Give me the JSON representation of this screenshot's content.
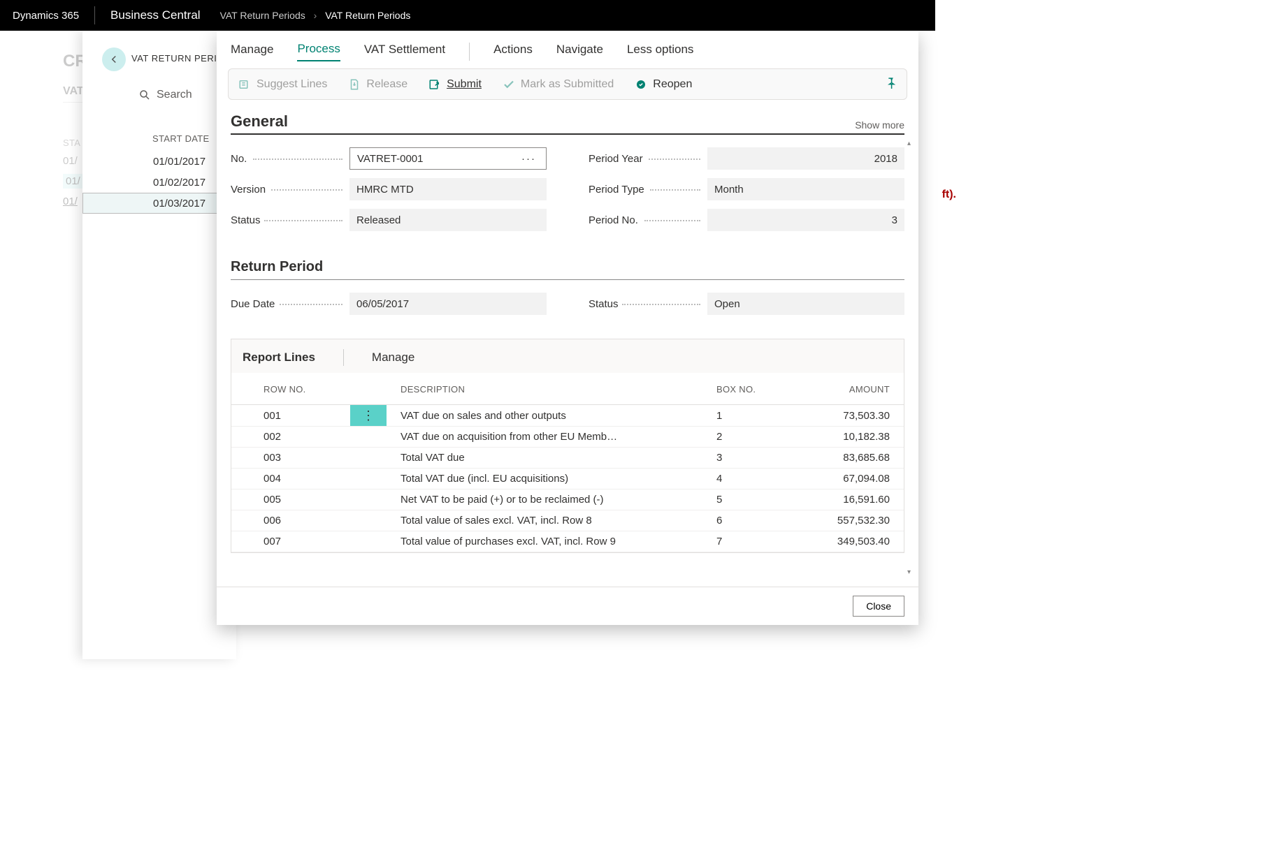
{
  "topbar": {
    "brand": "Dynamics 365",
    "app": "Business Central",
    "crumb1": "VAT Return Periods",
    "crumb2": "VAT Return Periods"
  },
  "bg": {
    "title": "CR",
    "sub": "VAT",
    "th": "STA",
    "rows": [
      "01/",
      "01/",
      "01/"
    ],
    "rightText": "ft)."
  },
  "listPanel": {
    "title": "VAT RETURN PERI",
    "searchPlaceholder": "Search",
    "header": "START DATE",
    "rows": [
      "01/01/2017",
      "01/02/2017",
      "01/03/2017"
    ],
    "selectedIndex": 2
  },
  "modal": {
    "tabs": [
      "Manage",
      "Process",
      "VAT Settlement",
      "Actions",
      "Navigate",
      "Less options"
    ],
    "activeTab": 1,
    "ribbon": {
      "suggest": "Suggest Lines",
      "release": "Release",
      "submit": "Submit",
      "mark": "Mark as Submitted",
      "reopen": "Reopen"
    },
    "general": {
      "title": "General",
      "showMore": "Show more",
      "noLabel": "No.",
      "noValue": "VATRET-0001",
      "versionLabel": "Version",
      "versionValue": "HMRC MTD",
      "statusLabel": "Status",
      "statusValue": "Released",
      "periodYearLabel": "Period Year",
      "periodYearValue": "2018",
      "periodTypeLabel": "Period Type",
      "periodTypeValue": "Month",
      "periodNoLabel": "Period No.",
      "periodNoValue": "3"
    },
    "returnPeriod": {
      "title": "Return Period",
      "dueLabel": "Due Date",
      "dueValue": "06/05/2017",
      "statusLabel": "Status",
      "statusValue": "Open"
    },
    "lines": {
      "tabs": [
        "Report Lines",
        "Manage"
      ],
      "columns": [
        "ROW NO.",
        "DESCRIPTION",
        "BOX NO.",
        "AMOUNT"
      ],
      "rows": [
        {
          "row": "001",
          "desc": "VAT due on sales and other outputs",
          "box": "1",
          "amount": "73,503.30"
        },
        {
          "row": "002",
          "desc": "VAT due on acquisition from other EU Memb…",
          "box": "2",
          "amount": "10,182.38"
        },
        {
          "row": "003",
          "desc": "Total VAT due",
          "box": "3",
          "amount": "83,685.68"
        },
        {
          "row": "004",
          "desc": "Total VAT due (incl. EU acquisitions)",
          "box": "4",
          "amount": "67,094.08"
        },
        {
          "row": "005",
          "desc": "Net VAT to be paid (+) or to be reclaimed (-)",
          "box": "5",
          "amount": "16,591.60"
        },
        {
          "row": "006",
          "desc": "Total value of sales excl. VAT, incl. Row 8",
          "box": "6",
          "amount": "557,532.30"
        },
        {
          "row": "007",
          "desc": "Total value of purchases excl. VAT, incl. Row 9",
          "box": "7",
          "amount": "349,503.40"
        }
      ]
    },
    "close": "Close"
  }
}
